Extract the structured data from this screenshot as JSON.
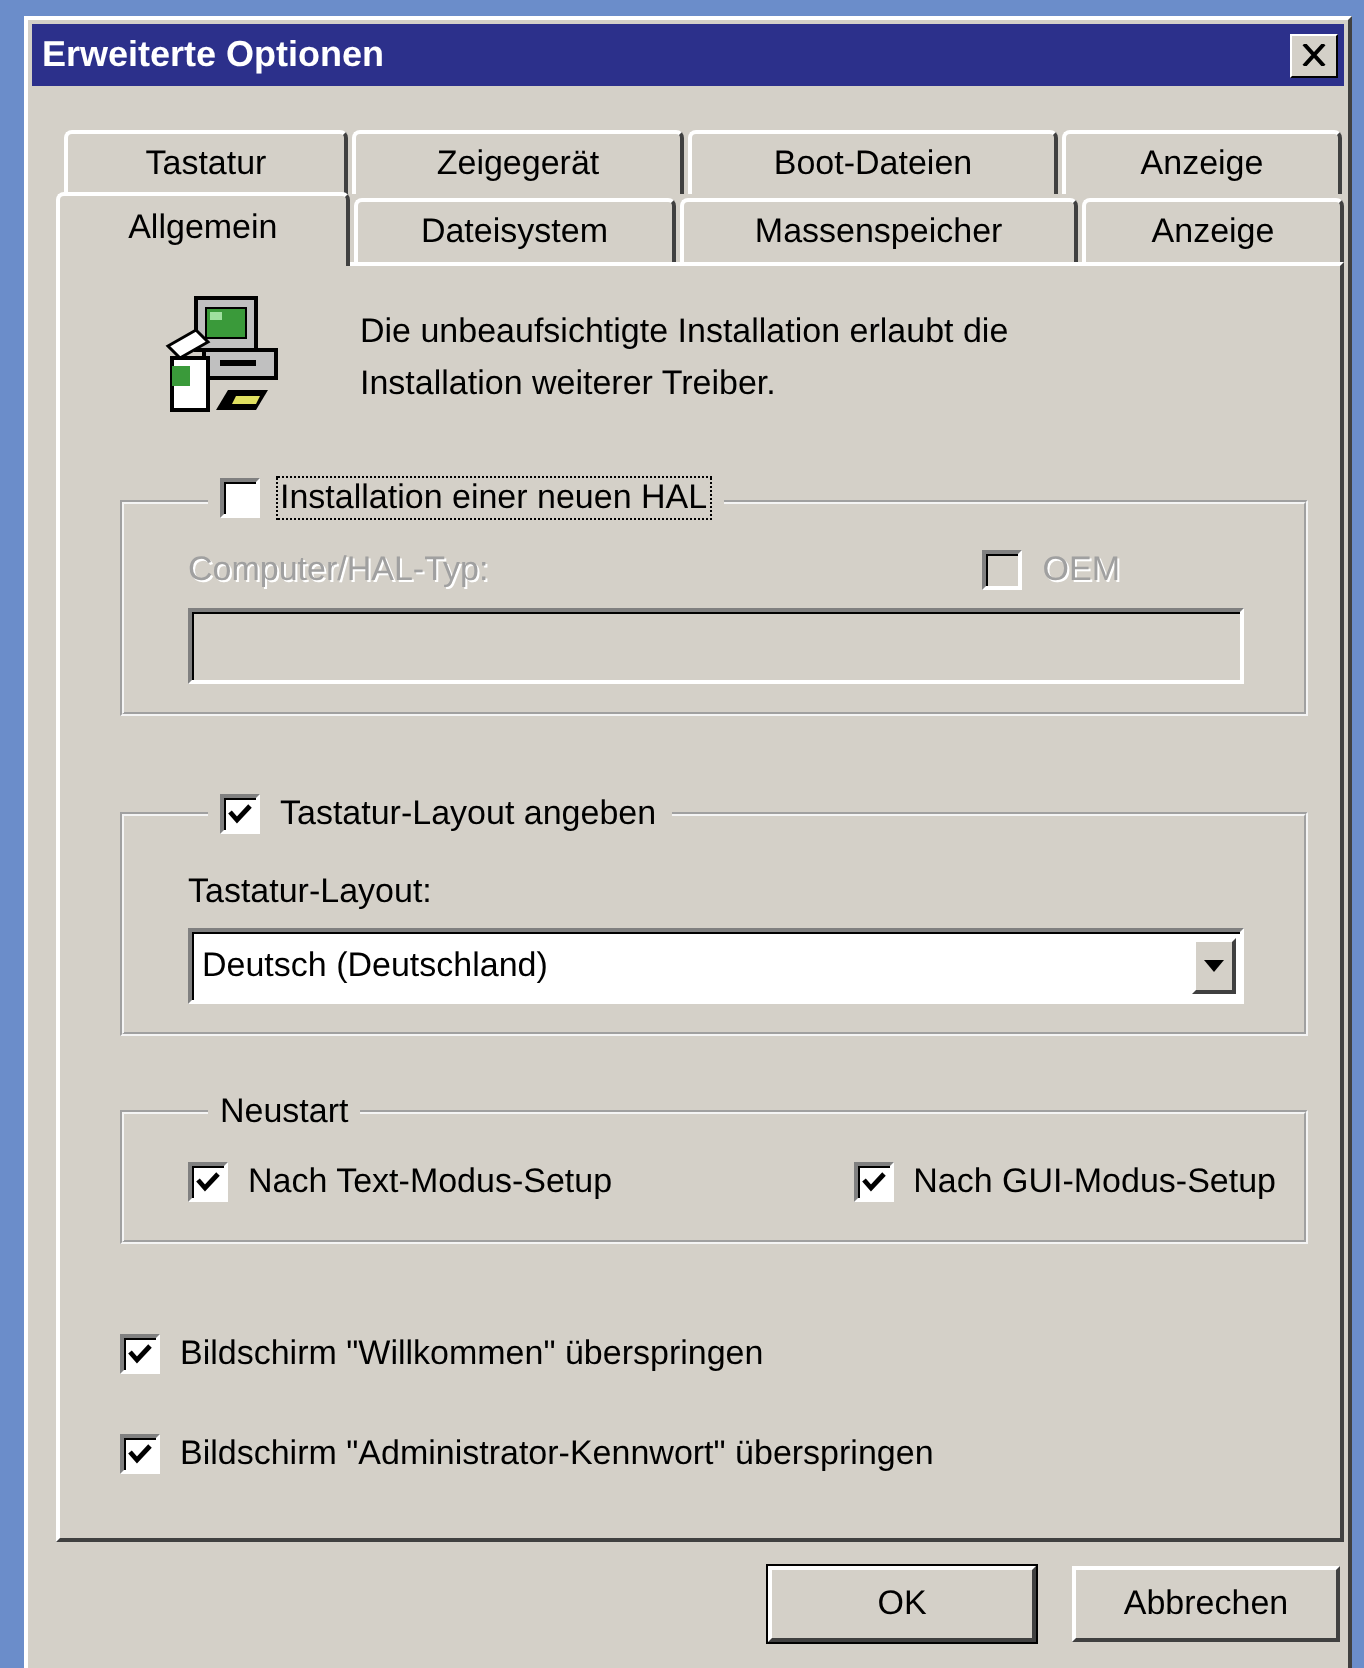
{
  "window": {
    "title": "Erweiterte Optionen"
  },
  "tab_rows": [
    {
      "tabs": [
        {
          "label": "Tastatur",
          "selected": false
        },
        {
          "label": "Zeigegerät",
          "selected": false
        },
        {
          "label": "Boot-Dateien",
          "selected": false
        },
        {
          "label": "Anzeige",
          "selected": false
        }
      ]
    },
    {
      "tabs": [
        {
          "label": "Allgemein",
          "selected": true
        },
        {
          "label": "Dateisystem",
          "selected": false
        },
        {
          "label": "Massenspeicher",
          "selected": false
        },
        {
          "label": "Anzeige",
          "selected": false
        }
      ]
    }
  ],
  "description": "Die unbeaufsichtigte Installation erlaubt die Installation weiterer Treiber.",
  "hal_group": {
    "checkbox": {
      "label": "Installation einer neuen HAL",
      "checked": false,
      "focused": true,
      "disabled": false
    },
    "type_label": "Computer/HAL-Typ:",
    "disabled": true,
    "oem": {
      "label": "OEM",
      "checked": false,
      "focused": false,
      "disabled": true
    }
  },
  "keyboard_group": {
    "checkbox": {
      "label": "Tastatur-Layout angeben",
      "checked": true,
      "focused": false,
      "disabled": false
    },
    "layout_label": "Tastatur-Layout:",
    "layout_value": "Deutsch (Deutschland)"
  },
  "restart_group": {
    "title": "Neustart",
    "options": [
      {
        "label": "Nach Text-Modus-Setup",
        "checked": true,
        "focused": false,
        "disabled": false
      },
      {
        "label": "Nach GUI-Modus-Setup",
        "checked": true,
        "focused": false,
        "disabled": false
      }
    ]
  },
  "options": [
    {
      "label": "Bildschirm \"Willkommen\" überspringen",
      "checked": true,
      "focused": false,
      "disabled": false
    },
    {
      "label": "Bildschirm \"Administrator-Kennwort\" überspringen",
      "checked": true,
      "focused": false,
      "disabled": false
    }
  ],
  "buttons": [
    {
      "label": "OK",
      "default": true
    },
    {
      "label": "Abbrechen",
      "default": false
    }
  ]
}
